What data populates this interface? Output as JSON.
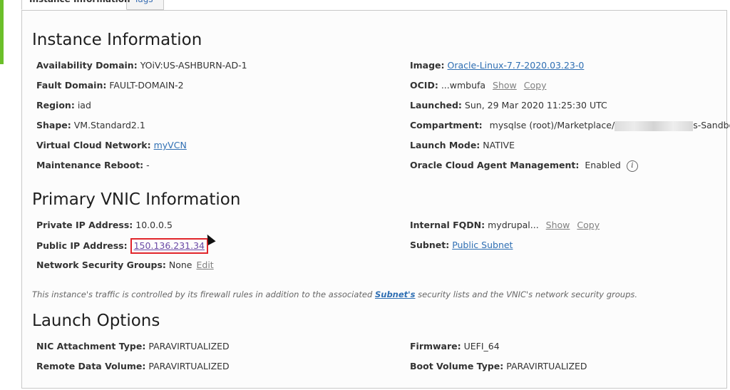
{
  "tabs": {
    "active": "Instance Information",
    "tags": "Tags"
  },
  "sections": {
    "instance": "Instance Information",
    "vnic": "Primary VNIC Information",
    "launch": "Launch Options"
  },
  "instance_left": {
    "availability_domain": {
      "label": "Availability Domain:",
      "value": "YOiV:US-ASHBURN-AD-1"
    },
    "fault_domain": {
      "label": "Fault Domain:",
      "value": "FAULT-DOMAIN-2"
    },
    "region": {
      "label": "Region:",
      "value": "iad"
    },
    "shape": {
      "label": "Shape:",
      "value": "VM.Standard2.1"
    },
    "vcn": {
      "label": "Virtual Cloud Network:",
      "value": "myVCN"
    },
    "maintenance": {
      "label": "Maintenance Reboot:",
      "value": "-"
    }
  },
  "instance_right": {
    "image": {
      "label": "Image:",
      "value": "Oracle-Linux-7.7-2020.03.23-0"
    },
    "ocid": {
      "label": "OCID:",
      "value": "...wmbufa",
      "show": "Show",
      "copy": "Copy"
    },
    "launched": {
      "label": "Launched:",
      "value": "Sun, 29 Mar 2020 11:25:30 UTC"
    },
    "compartment": {
      "label": "Compartment:",
      "value_start": "mysqlse (root)/Marketplace/",
      "value_end": "s-Sandbox"
    },
    "launch_mode": {
      "label": "Launch Mode:",
      "value": "NATIVE"
    },
    "agent": {
      "label": "Oracle Cloud Agent Management:",
      "value": "Enabled",
      "icon": "info-icon"
    }
  },
  "vnic_left": {
    "private_ip": {
      "label": "Private IP Address:",
      "value": "10.0.0.5"
    },
    "public_ip": {
      "label": "Public IP Address:",
      "value": "150.136.231.34"
    },
    "nsg": {
      "label": "Network Security Groups:",
      "value": "None",
      "edit": "Edit"
    }
  },
  "vnic_right": {
    "fqdn": {
      "label": "Internal FQDN:",
      "value": "mydrupal...",
      "show": "Show",
      "copy": "Copy"
    },
    "subnet": {
      "label": "Subnet:",
      "value": "Public Subnet"
    }
  },
  "note": {
    "before": "This instance's traffic is controlled by its firewall rules in addition to the associated ",
    "link": "Subnet's",
    "after": " security lists and the VNIC's network security groups."
  },
  "launch_left": {
    "nic": {
      "label": "NIC Attachment Type:",
      "value": "PARAVIRTUALIZED"
    },
    "remote": {
      "label": "Remote Data Volume:",
      "value": "PARAVIRTUALIZED"
    }
  },
  "launch_right": {
    "firmware": {
      "label": "Firmware:",
      "value": "UEFI_64"
    },
    "boot": {
      "label": "Boot Volume Type:",
      "value": "PARAVIRTUALIZED"
    }
  },
  "colors": {
    "link": "#2f6fb3",
    "highlight_box": "#e1252b",
    "accent_bar": "#6bbf2a"
  }
}
